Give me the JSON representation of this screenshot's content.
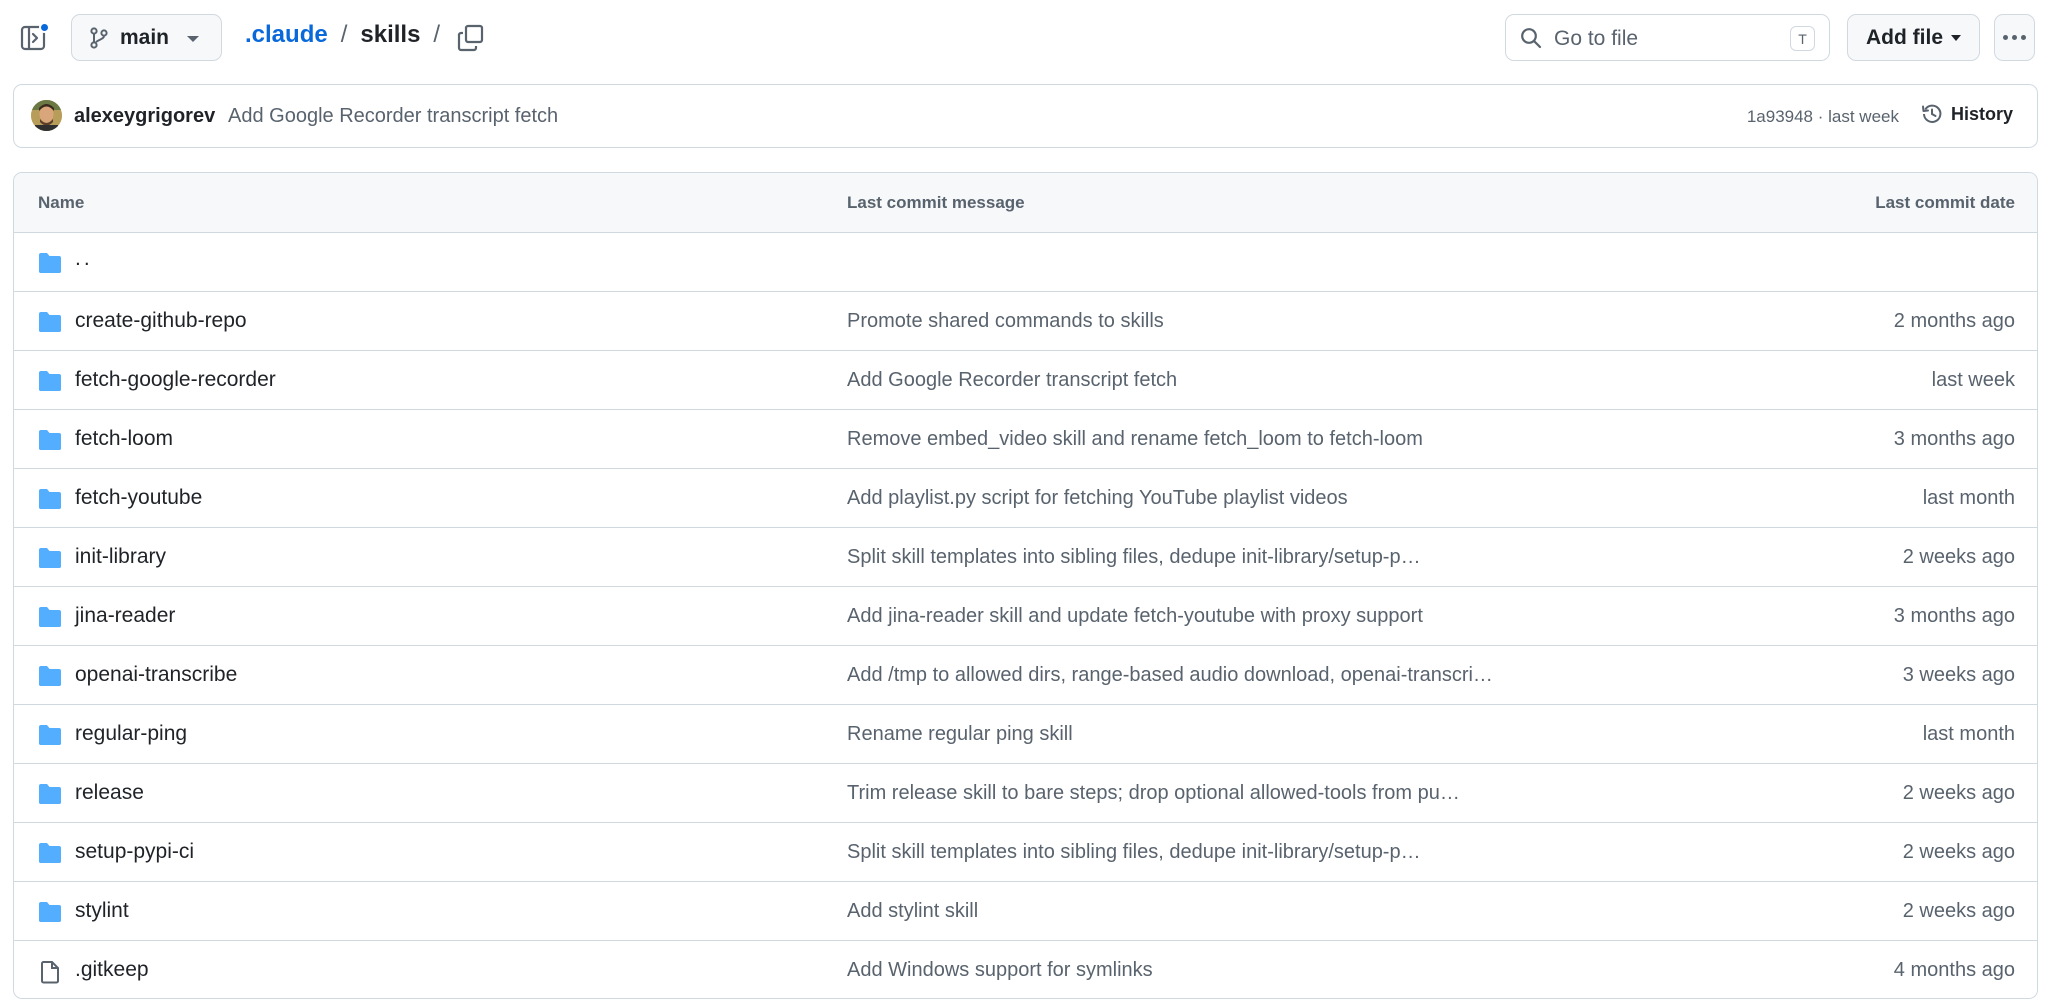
{
  "header": {
    "branch_label": "main",
    "breadcrumb": {
      "root": ".claude",
      "sep1": "/",
      "current": "skills",
      "sep2": "/"
    },
    "goto_placeholder": "Go to file",
    "goto_shortcut": "T",
    "add_file_label": "Add file",
    "accent_color": "#0969da"
  },
  "commit": {
    "author": "alexeygrigorev",
    "message": "Add Google Recorder transcript fetch",
    "hash": "1a93948",
    "meta_sep": " · ",
    "time": "last week",
    "history_label": "History"
  },
  "table": {
    "headers": {
      "name": "Name",
      "message": "Last commit message",
      "date": "Last commit date"
    },
    "rows": [
      {
        "type": "folder",
        "icon": "folder-icon",
        "name": "..",
        "message": "",
        "date": ""
      },
      {
        "type": "folder",
        "icon": "folder-icon",
        "name": "create-github-repo",
        "message": "Promote shared commands to skills",
        "date": "2 months ago"
      },
      {
        "type": "folder",
        "icon": "folder-icon",
        "name": "fetch-google-recorder",
        "message": "Add Google Recorder transcript fetch",
        "date": "last week"
      },
      {
        "type": "folder",
        "icon": "folder-icon",
        "name": "fetch-loom",
        "message": "Remove embed_video skill and rename fetch_loom to fetch-loom",
        "date": "3 months ago"
      },
      {
        "type": "folder",
        "icon": "folder-icon",
        "name": "fetch-youtube",
        "message": "Add playlist.py script for fetching YouTube playlist videos",
        "date": "last month"
      },
      {
        "type": "folder",
        "icon": "folder-icon",
        "name": "init-library",
        "message": "Split skill templates into sibling files, dedupe init-library/setup-p…",
        "date": "2 weeks ago"
      },
      {
        "type": "folder",
        "icon": "folder-icon",
        "name": "jina-reader",
        "message": "Add jina-reader skill and update fetch-youtube with proxy support",
        "date": "3 months ago"
      },
      {
        "type": "folder",
        "icon": "folder-icon",
        "name": "openai-transcribe",
        "message": "Add /tmp to allowed dirs, range-based audio download, openai-transcri…",
        "date": "3 weeks ago"
      },
      {
        "type": "folder",
        "icon": "folder-icon",
        "name": "regular-ping",
        "message": "Rename regular ping skill",
        "date": "last month"
      },
      {
        "type": "folder",
        "icon": "folder-icon",
        "name": "release",
        "message": "Trim release skill to bare steps; drop optional allowed-tools from pu…",
        "date": "2 weeks ago"
      },
      {
        "type": "folder",
        "icon": "folder-icon",
        "name": "setup-pypi-ci",
        "message": "Split skill templates into sibling files, dedupe init-library/setup-p…",
        "date": "2 weeks ago"
      },
      {
        "type": "folder",
        "icon": "folder-icon",
        "name": "stylint",
        "message": "Add stylint skill",
        "date": "2 weeks ago"
      },
      {
        "type": "file",
        "icon": "file-icon",
        "name": ".gitkeep",
        "message": "Add Windows support for symlinks",
        "date": "4 months ago"
      }
    ]
  },
  "colors": {
    "folder": "#54aeff",
    "text": "#1f2328",
    "muted": "#59636e",
    "border": "#d1d9e0",
    "header_bg": "#f6f8fa"
  }
}
